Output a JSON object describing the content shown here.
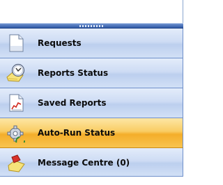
{
  "nav": {
    "items": [
      {
        "label": "Requests",
        "icon": "document-icon",
        "active": false
      },
      {
        "label": "Reports Status",
        "icon": "clock-icon",
        "active": false
      },
      {
        "label": "Saved Reports",
        "icon": "chart-document-icon",
        "active": false
      },
      {
        "label": "Auto-Run Status",
        "icon": "gear-icon",
        "active": true
      },
      {
        "label": "Message Centre (0)",
        "icon": "message-icon",
        "active": false
      }
    ]
  },
  "colors": {
    "accent_active": "#f9c34a",
    "item_background": "#cedcf4",
    "splitter": "#3e67b0"
  }
}
